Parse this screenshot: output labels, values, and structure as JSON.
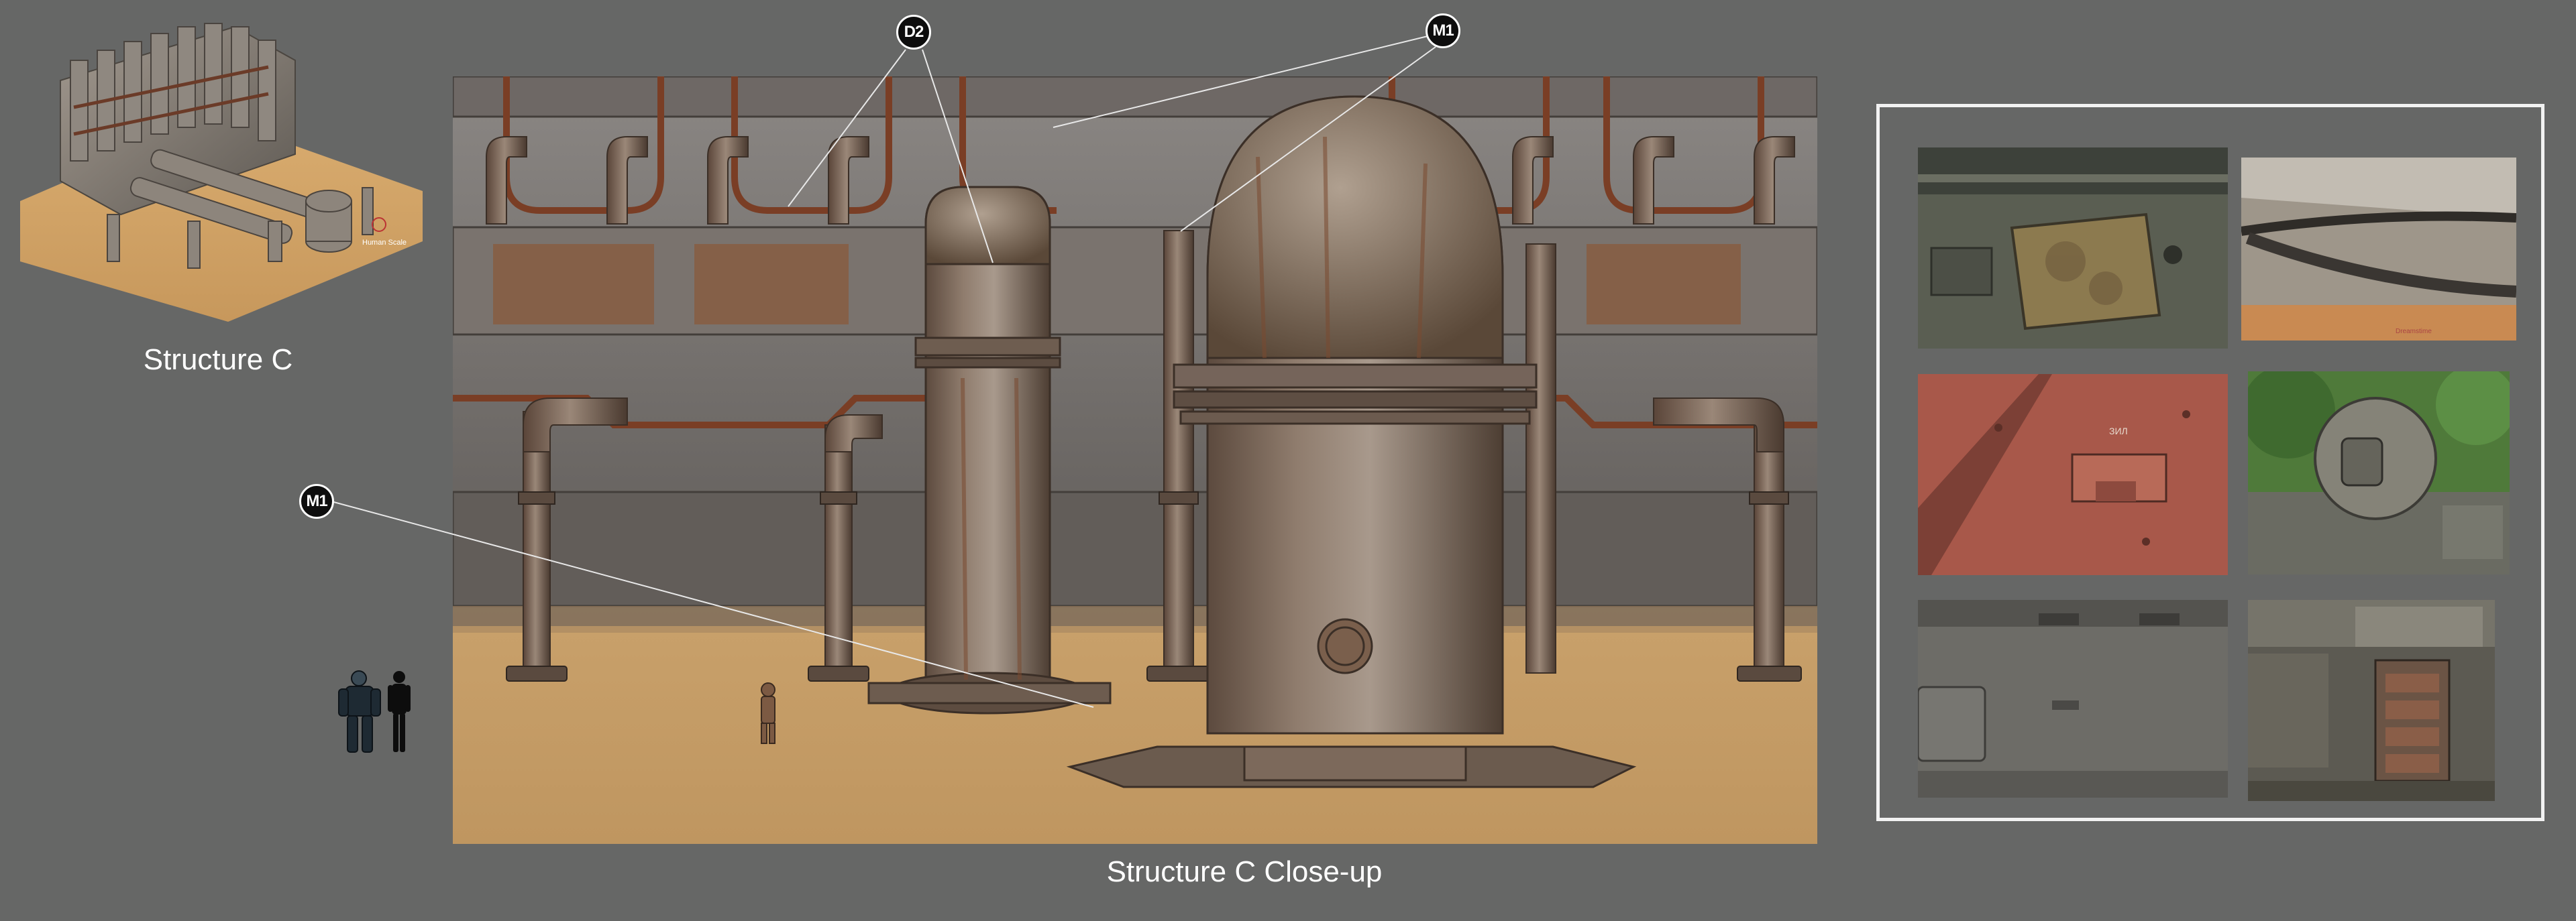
{
  "model_thumbnail": {
    "caption": "Structure C",
    "scale_label": "Human Scale"
  },
  "main_render": {
    "caption": "Structure C Close-up",
    "callouts": [
      {
        "id": "D2",
        "label": "D2"
      },
      {
        "id": "M1-top",
        "label": "M1"
      },
      {
        "id": "M1-left",
        "label": "M1"
      }
    ]
  },
  "reference_panel": {
    "photos": [
      {
        "subject": "rusted hatch on olive armored vehicle"
      },
      {
        "subject": "steel cables over wooden beam",
        "label": "Dreamstime"
      },
      {
        "subject": "red painted armor plate",
        "label": "ЗИЛ"
      },
      {
        "subject": "round turret hatch among trees"
      },
      {
        "subject": "grey armored hull with latches"
      },
      {
        "subject": "tank track and drive sprocket"
      }
    ]
  },
  "colors": {
    "background": "#666766",
    "sand": "#c99e63",
    "rust": "#8a5a3c",
    "steel": "#7d7d7a",
    "callout_fill": "#0d0d0d",
    "panel_border": "#f2f2f2"
  }
}
